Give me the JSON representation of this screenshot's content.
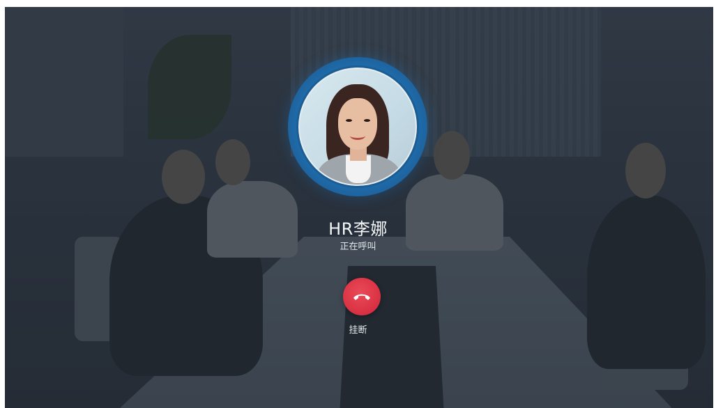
{
  "call": {
    "caller_name": "HR李娜",
    "status": "正在呼叫",
    "hangup_label": "挂断"
  },
  "icons": {
    "avatar": "caller-avatar",
    "hangup": "phone-hangup-icon"
  },
  "colors": {
    "ring": "#1f6fb0",
    "hangup": "#d83042",
    "text": "#f4f6f8"
  }
}
